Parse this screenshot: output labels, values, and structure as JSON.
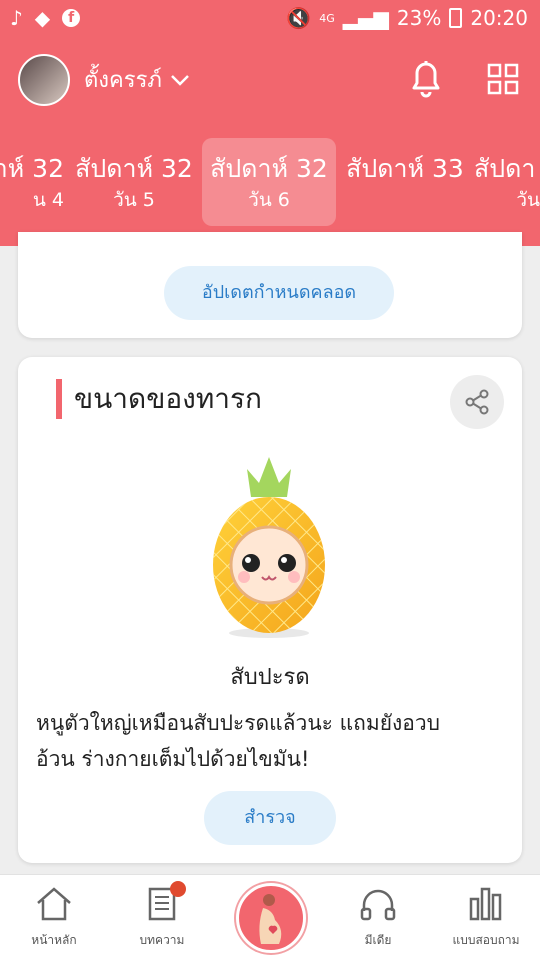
{
  "status_bar": {
    "battery": "23%",
    "time": "20:20",
    "network": "4G"
  },
  "header": {
    "username": "ตั้งครรภ์",
    "weeks": [
      {
        "title": "าห์ 32",
        "day": "น 4"
      },
      {
        "title": "สัปดาห์ 32",
        "day": "วัน 5"
      },
      {
        "title": "สัปดาห์ 32",
        "day": "วัน 6",
        "selected": true
      },
      {
        "title": "สัปดาห์ 33",
        "day": ""
      },
      {
        "title": "สัปดา",
        "day": "วัน"
      }
    ]
  },
  "due_card": {
    "button_label": "อัปเดตกำหนดคลอด"
  },
  "baby_size": {
    "title": "ขนาดของทารก",
    "fruit_name": "สับปะรด",
    "description_line1": "หนูตัวใหญ่เหมือนสับปะรดแล้วนะ แถมยังอวบ",
    "description_line2": "อ้วน ร่างกายเต็มไปด้วยไขมัน!",
    "explore_label": "สำรวจ"
  },
  "tabbar": {
    "items": [
      {
        "label": "หน้าหลัก",
        "icon": "home-icon"
      },
      {
        "label": "บทความ",
        "icon": "article-icon",
        "badge": true
      },
      {
        "label": "",
        "icon": "pregnancy-icon"
      },
      {
        "label": "มีเดีย",
        "icon": "headphones-icon"
      },
      {
        "label": "แบบสอบถาม",
        "icon": "chart-icon"
      }
    ]
  },
  "colors": {
    "brand": "#f2666e",
    "accent_blue": "#2a7cc7",
    "pill_bg": "#e3f1fb"
  }
}
